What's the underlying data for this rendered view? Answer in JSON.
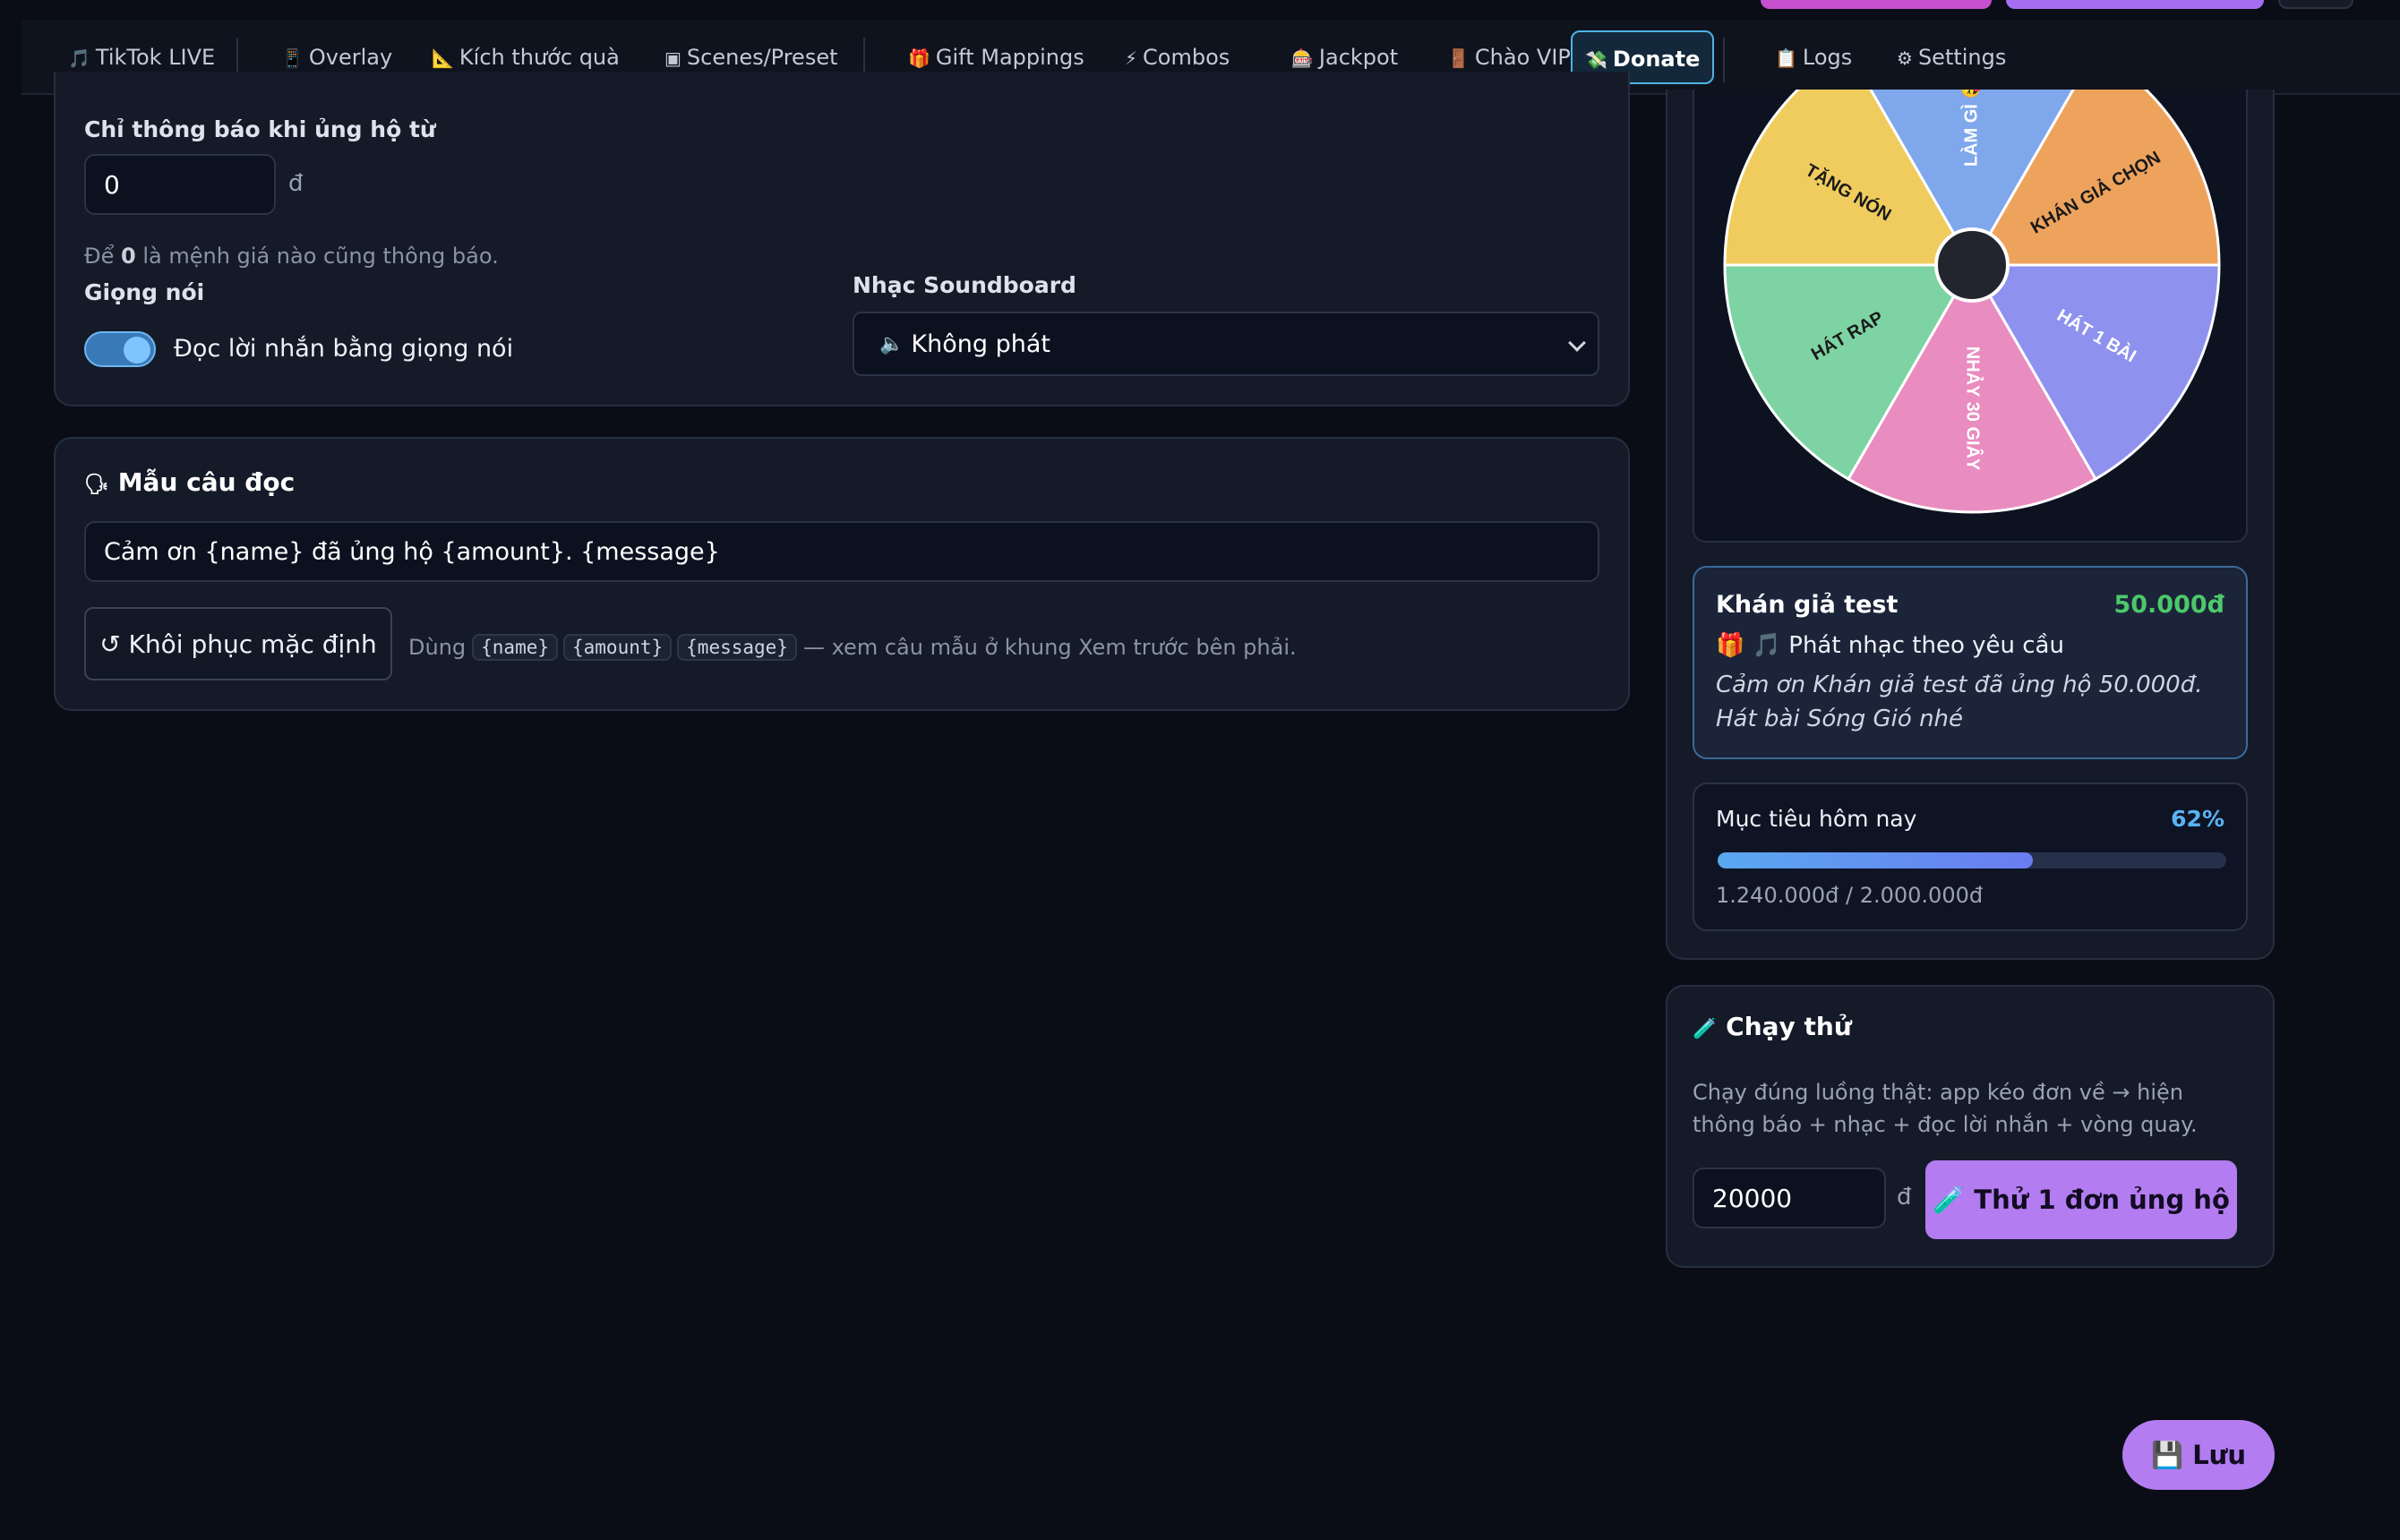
{
  "nav": {
    "items": [
      {
        "icon": "🎵",
        "label": "TikTok LIVE"
      },
      {
        "icon": "📱",
        "label": "Overlay"
      },
      {
        "icon": "📐",
        "label": "Kích thước quà"
      },
      {
        "icon": "▣",
        "label": "Scenes/Preset"
      },
      {
        "icon": "🎁",
        "label": "Gift Mappings"
      },
      {
        "icon": "⚡",
        "label": "Combos"
      },
      {
        "icon": "🎰",
        "label": "Jackpot"
      },
      {
        "icon": "🚪",
        "label": "Chào VIP"
      },
      {
        "icon": "💸",
        "label": "Donate"
      },
      {
        "icon": "📋",
        "label": "Logs"
      },
      {
        "icon": "⚙",
        "label": "Settings"
      }
    ],
    "active": "Donate"
  },
  "notify": {
    "label": "Chỉ thông báo khi ủng hộ từ",
    "value": "0",
    "unit": "đ",
    "hint_prefix": "Để",
    "hint_bold": "0",
    "hint_suffix": "là mệnh giá nào cũng thông báo."
  },
  "voice": {
    "label": "Giọng nói",
    "toggle_label": "Đọc lời nhắn bằng giọng nói",
    "toggle_on": true
  },
  "soundboard": {
    "label": "Nhạc Soundboard",
    "icon": "🔈",
    "selected": "Không phát"
  },
  "template": {
    "icon": "🗣",
    "title": "Mẫu câu đọc",
    "value": "Cảm ơn {name} đã ủng hộ {amount}. {message}",
    "reset_button": "↺ Khôi phục mặc định",
    "hint_prefix": "Dùng",
    "tokens": [
      "{name}",
      "{amount}",
      "{message}"
    ],
    "hint_suffix": "— xem câu mẫu ở khung Xem trước bên phải."
  },
  "wheel": {
    "segments": [
      {
        "label": "LÀM GÌ 😜",
        "color": "#7fa7ec"
      },
      {
        "label": "KHÁN GIẢ CHỌN",
        "color": "#eea35c"
      },
      {
        "label": "HÁT 1 BÀI",
        "color": "#8e92ee"
      },
      {
        "label": "NHẢY 30 GIÂY",
        "color": "#e98cc0"
      },
      {
        "label": "HÁT RAP",
        "color": "#7dd3a3"
      },
      {
        "label": "TẶNG NÓN",
        "color": "#f0cc5e"
      }
    ]
  },
  "donor_preview": {
    "name": "Khán giả test",
    "amount": "50.000đ",
    "gift_line": "🎁 🎵 Phát nhạc theo yêu cầu",
    "message": "Cảm ơn Khán giả test đã ủng hộ 50.000đ. Hát bài Sóng Gió nhé"
  },
  "goal": {
    "label": "Mục tiêu hôm nay",
    "percent_text": "62%",
    "progress": 0.62,
    "amounts": "1.240.000đ / 2.000.000đ"
  },
  "test_run": {
    "icon": "🧪",
    "title": "Chạy thử",
    "description": "Chạy đúng luồng thật: app kéo đơn về → hiện thông báo + nhạc + đọc lời nhắn + vòng quay.",
    "amount": "20000",
    "unit": "đ",
    "button": "🧪 Thử 1 đơn ủng hộ"
  },
  "save_button": "💾 Lưu",
  "colors": {
    "accent": "#b37cf0",
    "active_border": "#4fb3e6",
    "amount_green": "#4cc96a",
    "percent_blue": "#5ab4f2"
  }
}
